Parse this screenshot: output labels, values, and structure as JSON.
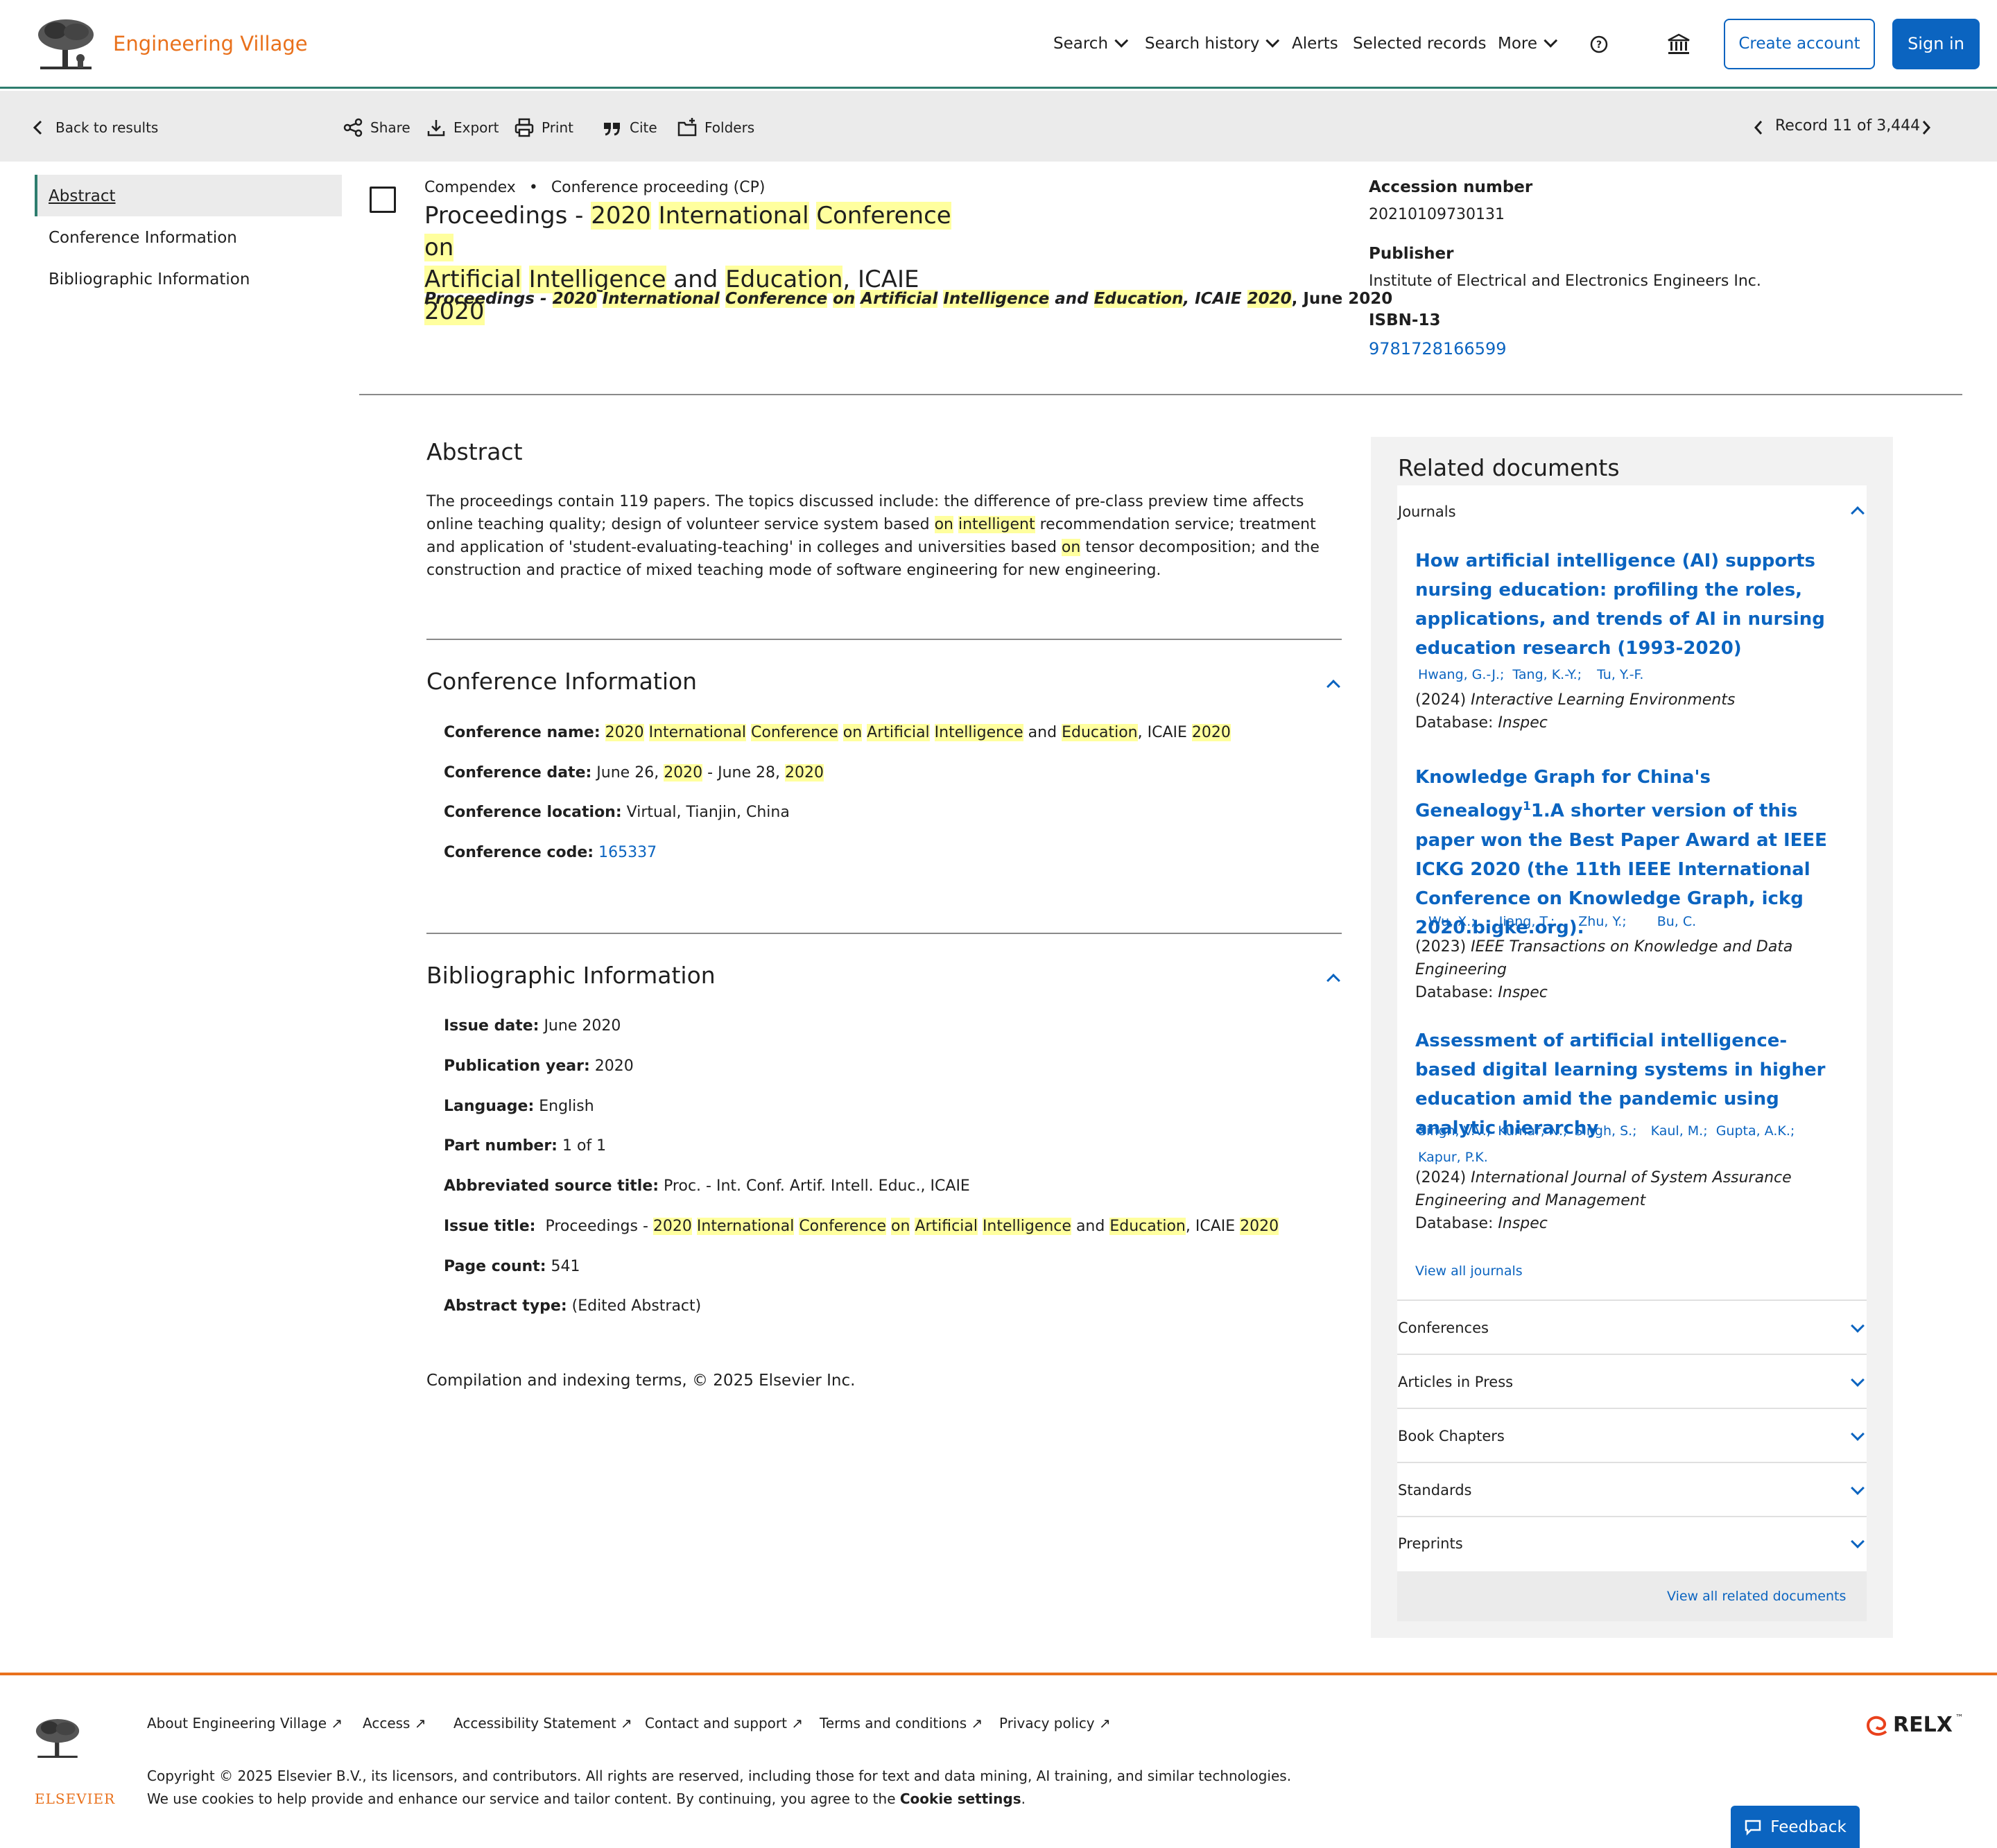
{
  "header": {
    "brand": "Engineering Village",
    "nav": {
      "search": "Search",
      "search_history": "Search history",
      "alerts": "Alerts",
      "selected_records": "Selected records",
      "more": "More"
    },
    "create_account": "Create account",
    "sign_in": "Sign in"
  },
  "toolbar": {
    "back": "Back to results",
    "share": "Share",
    "export": "Export",
    "print": "Print",
    "cite": "Cite",
    "folders": "Folders",
    "record_position": "Record 11 of 3,444"
  },
  "side_nav": {
    "items": [
      "Abstract",
      "Conference Information",
      "Bibliographic Information"
    ]
  },
  "record": {
    "database": "Compendex",
    "doc_type": "Conference proceeding (CP)",
    "title_line1_parts": [
      "Proceedings - ",
      "2020",
      " ",
      "International",
      " ",
      "Conference",
      " ",
      "on"
    ],
    "title_line2_parts": [
      "Artificial",
      " ",
      "Intelligence",
      " and ",
      "Education",
      ", ICAIE ",
      "2020"
    ],
    "source": {
      "prefix": "Proceedings - ",
      "p2020a": "2020",
      "international": "International",
      "conference": "Conference",
      "on": "on",
      "artificial": "Artificial",
      "intelligence": "Intelligence",
      "and": " and ",
      "education": "Education",
      "icaie": ", ICAIE ",
      "p2020b": "2020",
      "date": ", June 2020"
    },
    "accession_label": "Accession number",
    "accession_value": "20210109730131",
    "publisher_label": "Publisher",
    "publisher_value": "Institute of Electrical and Electronics Engineers Inc.",
    "isbn_label": "ISBN-13",
    "isbn_value": "9781728166599"
  },
  "abstract": {
    "heading": "Abstract",
    "p1": "The proceedings contain 119 papers. The topics discussed include: the difference of pre-class preview time affects online teaching quality; design of volunteer service system based ",
    "on1": "on",
    "sp": " ",
    "intelligent": "intelligent",
    "p2": " recommendation service; treatment and application of 'student-evaluating-teaching' in colleges and universities based ",
    "on2": "on",
    "p3": " tensor decomposition; and the construction and practice of mixed teaching mode of software engineering for new engineering."
  },
  "conference": {
    "heading": "Conference Information",
    "name_label": "Conference name:",
    "date_label": "Conference date:",
    "date_p1": " June 26, ",
    "date_y1": "2020",
    "date_p2": " - June 28, ",
    "date_y2": "2020",
    "location_label": "Conference location:",
    "location_value": " Virtual, Tianjin, China",
    "code_label": "Conference code:",
    "code_value": "165337"
  },
  "biblio": {
    "heading": "Bibliographic Information",
    "issue_date_label": "Issue date:",
    "issue_date_value": " June 2020",
    "pub_year_label": "Publication year:",
    "pub_year_value": " 2020",
    "language_label": "Language:",
    "language_value": " English",
    "part_label": "Part number:",
    "part_value": " 1 of 1",
    "abbrev_label": "Abbreviated source title:",
    "abbrev_value": " Proc. - Int. Conf. Artif. Intell. Educ., ICAIE",
    "issue_title_label": "Issue title:",
    "issue_title_prefix": "  Proceedings - ",
    "page_count_label": "Page count:",
    "page_count_value": " 541",
    "abstract_type_label": "Abstract type:",
    "abstract_type_value": " (Edited Abstract)"
  },
  "copyright_note": "Compilation and indexing terms, © 2025 Elsevier Inc.",
  "related": {
    "heading": "Related documents",
    "journals_label": "Journals",
    "docs": [
      {
        "title": "How artificial intelligence (AI) supports nursing education: profiling the roles, applications, and trends of AI in nursing education research (1993-2020)",
        "authors": [
          "Hwang, G.-J.;",
          "Tang, K.-Y.;",
          "Tu, Y.-F."
        ],
        "year": "(2024) ",
        "venue": "Interactive Learning Environments",
        "db_label": "Database: ",
        "db": "Inspec"
      },
      {
        "title": "Knowledge Graph for China's Genealogy",
        "title_sup": "1",
        "title_rest": "1.A shorter version of this paper won the Best Paper Award at IEEE ICKG 2020 (the 11th IEEE International Conference on Knowledge Graph, ickg 2020.bigke.org).",
        "authors": [
          "Wu, X.;",
          "Jiang, T.;",
          "Zhu, Y.;",
          "Bu, C."
        ],
        "year": "(2023) ",
        "venue": "IEEE Transactions on Knowledge and Data Engineering",
        "db_label": "Database: ",
        "db": "Inspec"
      },
      {
        "title": "Assessment of artificial intelligence-based digital learning systems in higher education amid the pandemic using analytic hierarchy",
        "authors": [
          "Singh, V.V.;",
          "Kumar, N.;",
          "Singh, S.;",
          "Kaul, M.;",
          "Gupta, A.K.;",
          "Kapur, P.K."
        ],
        "year": "(2024) ",
        "venue": "International Journal of System Assurance Engineering and Management",
        "db_label": "Database: ",
        "db": "Inspec"
      }
    ],
    "view_all_journals": "View all journals",
    "sections": [
      "Conferences",
      "Articles in Press",
      "Book Chapters",
      "Standards",
      "Preprints"
    ],
    "view_all_related": "View all related documents"
  },
  "footer": {
    "links": [
      "About Engineering Village",
      "Access",
      "Accessibility Statement",
      "Contact and support",
      "Terms and conditions",
      "Privacy policy"
    ],
    "copyright": "Copyright © 2025 Elsevier B.V., its licensors, and contributors. All rights are reserved, including those for text and data mining, AI training, and similar technologies.",
    "cookies_prefix": "We use cookies to help provide and enhance our service and tailor content. By continuing, you agree to the ",
    "cookie_settings": "Cookie settings",
    "cookies_suffix": ".",
    "elsevier_word": "ELSEVIER",
    "relx_word": "RELX",
    "feedback": "Feedback"
  },
  "colors": {
    "accent_blue": "#0b64c0",
    "brand_orange": "#e9711c",
    "highlight": "#ffff9e",
    "header_rule": "#2e7d6e"
  }
}
